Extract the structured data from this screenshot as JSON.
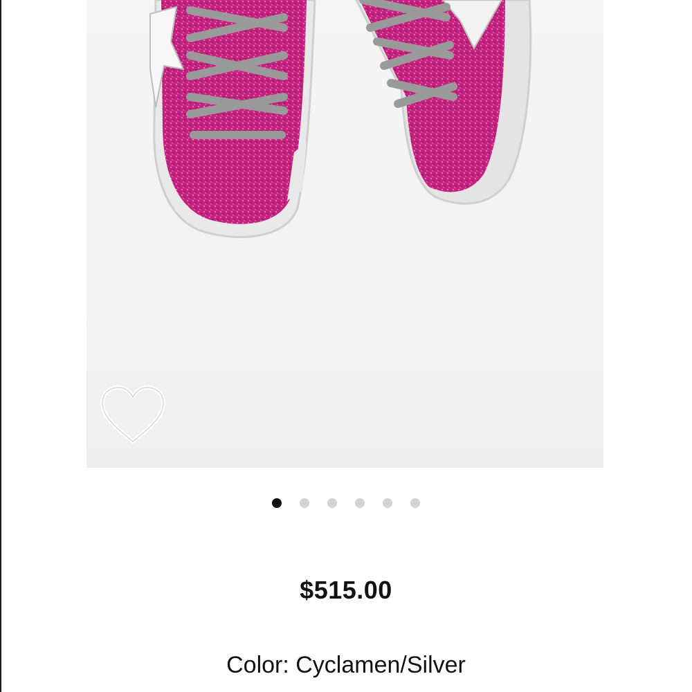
{
  "product": {
    "image_description_icon": "product-photo",
    "gallery": {
      "count": 6,
      "active_index": 0
    },
    "favorite_icon": "heart-outline-icon",
    "price": "$515.00",
    "color_label": "Color: Cyclamen/Silver"
  },
  "colors": {
    "glitter": "#c2237f",
    "dot_active": "#111111",
    "dot_inactive": "#d3d3d3"
  }
}
